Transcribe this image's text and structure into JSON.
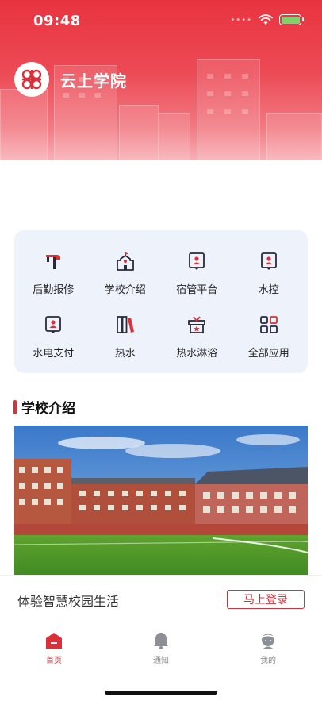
{
  "status_bar": {
    "time": "09:48"
  },
  "header": {
    "app_title": "云上学院",
    "logo_icon": "china-unicom-knot-icon"
  },
  "colors": {
    "brand_red": "#d9303a",
    "header_gradient_top": "#e8333f",
    "grid_bg": "#eef3fb"
  },
  "grid": {
    "items": [
      {
        "label": "后勤报修",
        "icon": "hammer-icon"
      },
      {
        "label": "学校介绍",
        "icon": "school-icon"
      },
      {
        "label": "宿管平台",
        "icon": "dorm-badge-icon"
      },
      {
        "label": "水控",
        "icon": "water-control-icon"
      },
      {
        "label": "水电支付",
        "icon": "payment-icon"
      },
      {
        "label": "热水",
        "icon": "books-icon"
      },
      {
        "label": "热水淋浴",
        "icon": "gift-box-icon"
      },
      {
        "label": "全部应用",
        "icon": "all-apps-icon"
      }
    ]
  },
  "section": {
    "title": "学校介绍"
  },
  "login_bar": {
    "text": "体验智慧校园生活",
    "button_label": "马上登录"
  },
  "tabbar": {
    "tabs": [
      {
        "label": "首页",
        "icon": "home-icon",
        "active": true
      },
      {
        "label": "通知",
        "icon": "bell-icon",
        "active": false
      },
      {
        "label": "我的",
        "icon": "profile-icon",
        "active": false
      }
    ]
  }
}
